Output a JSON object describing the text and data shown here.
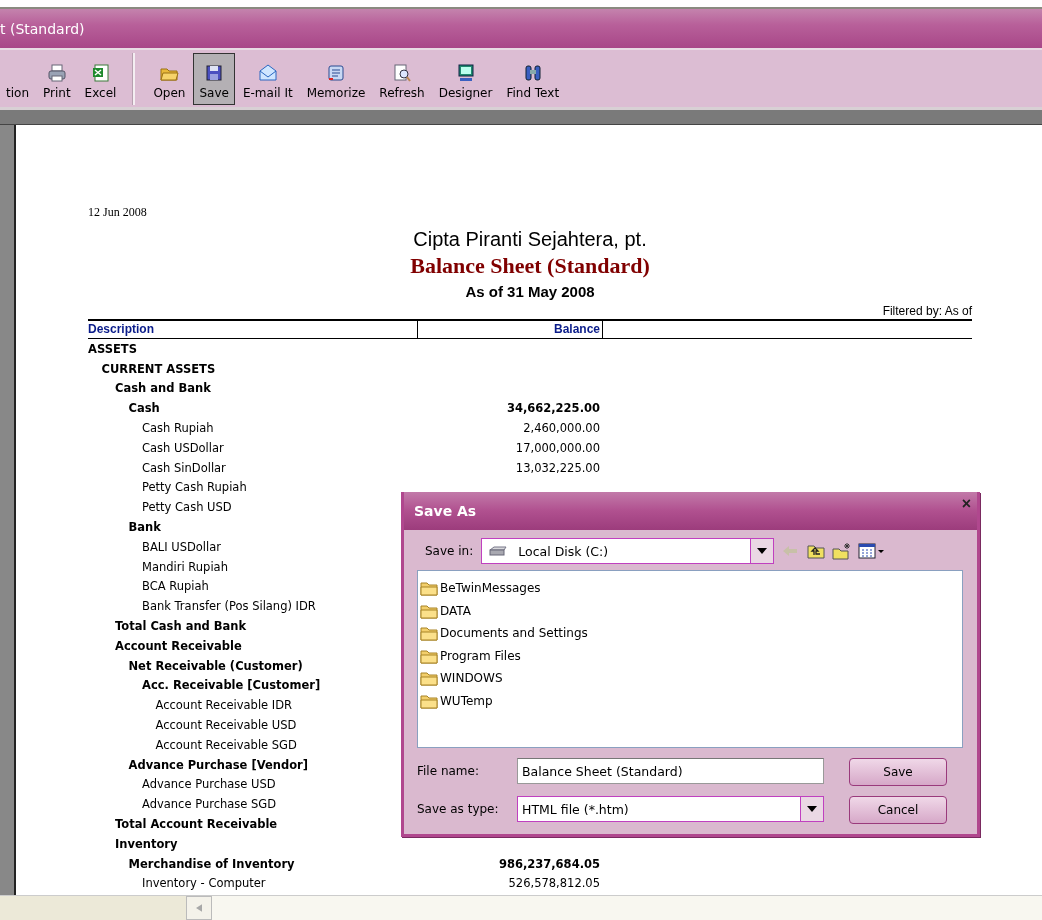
{
  "window": {
    "title": "t (Standard)"
  },
  "toolbar": [
    {
      "label": "tion",
      "pressed": false
    },
    {
      "label": "Print",
      "pressed": false
    },
    {
      "label": "Excel",
      "pressed": false
    },
    {
      "label": "Open",
      "pressed": false
    },
    {
      "label": "Save",
      "pressed": true
    },
    {
      "label": "E-mail It",
      "pressed": false
    },
    {
      "label": "Memorize",
      "pressed": false
    },
    {
      "label": "Refresh",
      "pressed": false
    },
    {
      "label": "Designer",
      "pressed": false
    },
    {
      "label": "Find Text",
      "pressed": false
    }
  ],
  "report": {
    "date": "12 Jun 2008",
    "company": "Cipta Piranti Sejahtera, pt.",
    "title": "Balance Sheet (Standard)",
    "period": "As of 31 May 2008",
    "filter": "Filtered by: As of",
    "columns": [
      "Description",
      "Balance"
    ],
    "rows": [
      {
        "bold": true,
        "label": "ASSETS",
        "children": [
          {
            "bold": true,
            "label": "CURRENT ASSETS",
            "children": [
              {
                "bold": true,
                "label": "Cash and Bank",
                "children": [
                  {
                    "bold": true,
                    "label": "Cash",
                    "balance": "34,662,225.00",
                    "children": [
                      {
                        "bold": false,
                        "label": "Cash Rupiah",
                        "balance": "2,460,000.00"
                      },
                      {
                        "bold": false,
                        "label": "Cash USDollar",
                        "balance": "17,000,000.00"
                      },
                      {
                        "bold": false,
                        "label": "Cash SinDollar",
                        "balance": "13,032,225.00"
                      },
                      {
                        "bold": false,
                        "label": "Petty Cash Rupiah"
                      },
                      {
                        "bold": false,
                        "label": "Petty Cash USD"
                      }
                    ]
                  },
                  {
                    "bold": true,
                    "label": "Bank",
                    "children": [
                      {
                        "bold": false,
                        "label": "BALI USDollar"
                      },
                      {
                        "bold": false,
                        "label": "Mandiri Rupiah"
                      },
                      {
                        "bold": false,
                        "label": "BCA Rupiah"
                      },
                      {
                        "bold": false,
                        "label": "Bank Transfer (Pos Silang) IDR"
                      }
                    ]
                  }
                ]
              },
              {
                "bold": true,
                "label": "Total Cash and Bank"
              },
              {
                "bold": true,
                "label": "Account Receivable",
                "children": [
                  {
                    "bold": true,
                    "label": "Net Receivable (Customer)",
                    "children": [
                      {
                        "bold": true,
                        "label": "Acc. Receivable [Customer]",
                        "children": [
                          {
                            "bold": false,
                            "label": "Account Receivable IDR"
                          },
                          {
                            "bold": false,
                            "label": "Account Receivable USD"
                          },
                          {
                            "bold": false,
                            "label": "Account Receivable SGD"
                          }
                        ]
                      }
                    ]
                  },
                  {
                    "bold": true,
                    "label": "Advance Purchase [Vendor]",
                    "children": [
                      {
                        "bold": false,
                        "label": "Advance Purchase USD"
                      },
                      {
                        "bold": false,
                        "label": "Advance Purchase SGD"
                      }
                    ]
                  }
                ]
              },
              {
                "bold": true,
                "label": "Total Account Receivable"
              },
              {
                "bold": true,
                "label": "Inventory",
                "children": [
                  {
                    "bold": true,
                    "label": "Merchandise of Inventory",
                    "balance": "986,237,684.05",
                    "children": [
                      {
                        "bold": false,
                        "label": "Inventory - Computer",
                        "balance": "526,578,812.05"
                      }
                    ]
                  }
                ]
              }
            ]
          }
        ]
      }
    ]
  },
  "dialog": {
    "title": "Save As",
    "close": "×",
    "save_in_label": "Save in:",
    "save_in": "Local Disk (C:)",
    "files": [
      "BeTwinMessages",
      "DATA",
      "Documents and Settings",
      "Program Files",
      "WINDOWS",
      "WUTemp"
    ],
    "file_name_label": "File name:",
    "file_name": "Balance Sheet (Standard)",
    "type_label": "Save as type:",
    "type": "HTML file (*.htm)",
    "buttons": [
      "Save",
      "Cancel"
    ]
  }
}
